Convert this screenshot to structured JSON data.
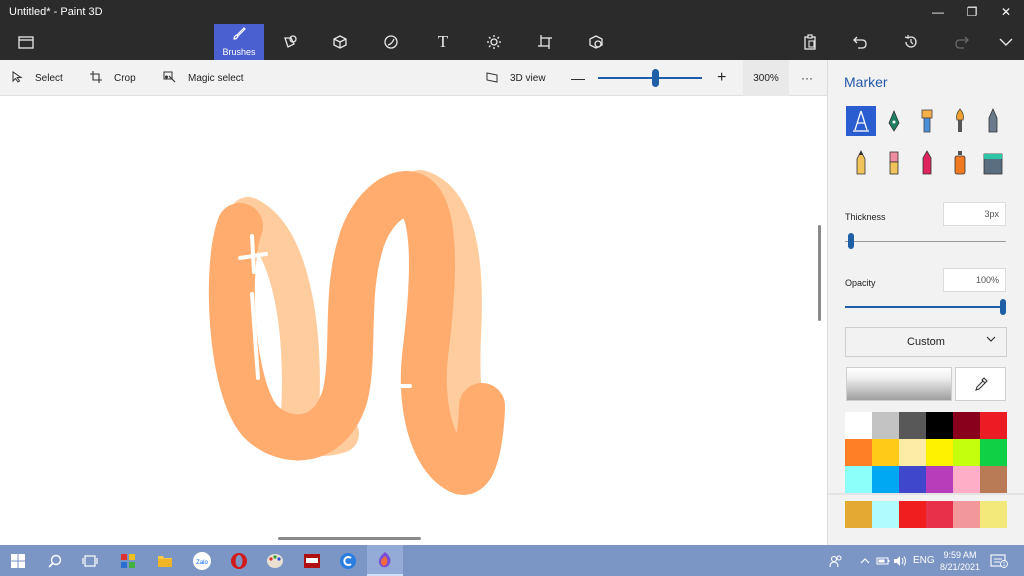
{
  "window": {
    "title": "Untitled* - Paint 3D"
  },
  "ribbon": {
    "active_label": "Brushes"
  },
  "toolbar": {
    "select_label": "Select",
    "crop_label": "Crop",
    "magic_select_label": "Magic select",
    "view3d_label": "3D view",
    "zoom_value": "300%",
    "zoom_level_fraction": 0.55,
    "more": "···"
  },
  "panel": {
    "title": "Marker",
    "thickness_label": "Thickness",
    "thickness_value": "3px",
    "thickness_fraction": 0.02,
    "opacity_label": "Opacity",
    "opacity_value": "100%",
    "opacity_fraction": 1.0,
    "dropdown_value": "Custom",
    "swatches": [
      "#ffffff",
      "#c3c3c3",
      "#585858",
      "#000000",
      "#88001b",
      "#ec1c24",
      "#ff7f27",
      "#ffca18",
      "#fdeca6",
      "#fff200",
      "#c4ff0e",
      "#0ed145",
      "#8cfffb",
      "#00a8f3",
      "#3f48cc",
      "#b83dba",
      "#ffaec8",
      "#b97a56"
    ],
    "custom_swatches": [
      "#e3a933",
      "#b0fbfb",
      "#f01e1e",
      "#e8304a",
      "#f2979a",
      "#f3e87a"
    ]
  },
  "taskbar": {
    "input_lang": "ENG",
    "time": "9:59 AM",
    "date": "8/21/2021",
    "zalo": "Zalo",
    "notif_count": "1"
  },
  "colors": {
    "accent": "#4a5fd0",
    "stroke_main": "#ffac6e",
    "stroke_light": "#ffcc9e"
  }
}
